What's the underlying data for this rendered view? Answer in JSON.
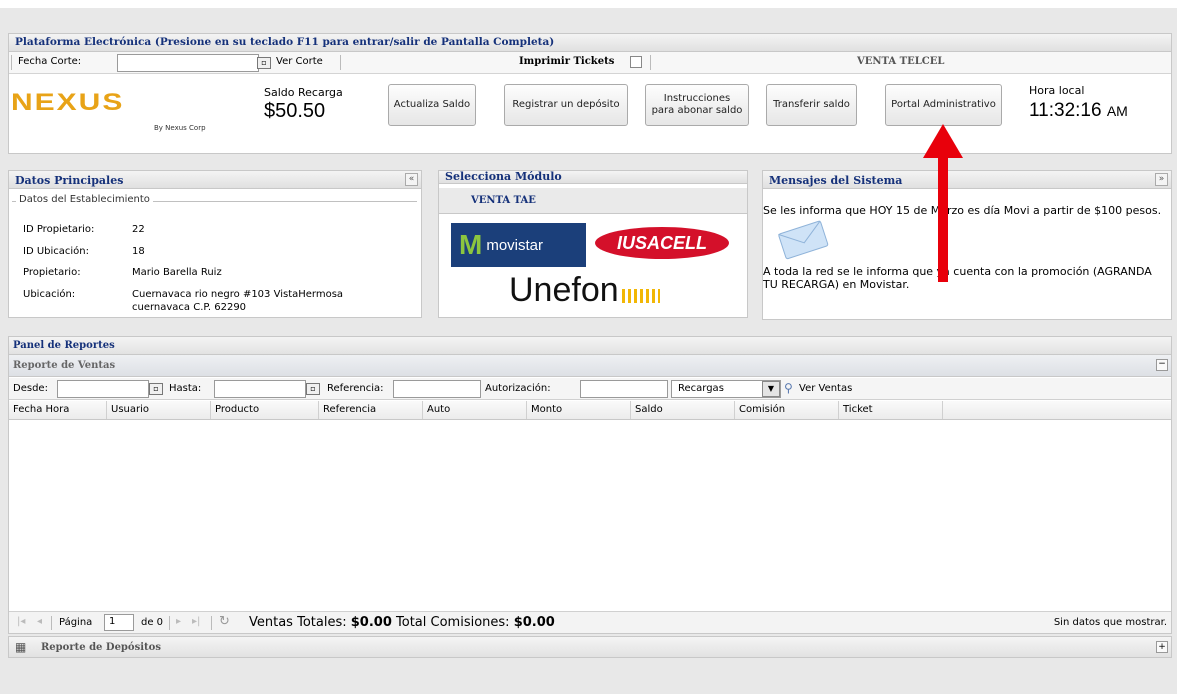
{
  "header": {
    "title": "Plataforma Electrónica (Presione en su teclado F11 para entrar/salir de Pantalla Completa)",
    "fecha_corte_label": "Fecha Corte:",
    "ver_corte_label": "Ver Corte",
    "imprimir_tickets_label": "Imprimir Tickets",
    "venta_label": "VENTA TELCEL"
  },
  "brand": {
    "logo_text": "NEXUS",
    "logo_sub": "By Nexus Corp",
    "accent": "#e8a317"
  },
  "balance": {
    "label": "Saldo Recarga",
    "value": "$50.50"
  },
  "toolbar": {
    "actualiza_label": "Actualiza Saldo",
    "registrar_label": "Registrar un depósito",
    "instrucciones_line1": "Instrucciones",
    "instrucciones_line2": "para abonar saldo",
    "transferir_label": "Transferir saldo",
    "portal_label": "Portal Administrativo"
  },
  "clock": {
    "label": "Hora local",
    "time": "11:32:16",
    "ampm": "AM"
  },
  "datos": {
    "title": "Datos Principales",
    "collapse_icon": "«",
    "fieldset": "Datos del Establecimiento",
    "rows": [
      {
        "label": "ID Propietario:",
        "value": "22"
      },
      {
        "label": "ID Ubicación:",
        "value": "18"
      },
      {
        "label": "Propietario:",
        "value": "Mario Barella Ruiz"
      },
      {
        "label": "Ubicación:",
        "value": "Cuernavaca rio negro #103 VistaHermosa",
        "value2": "cuernavaca C.P. 62290"
      }
    ]
  },
  "modulo": {
    "title": "Selecciona Módulo",
    "tab": "VENTA TAE",
    "movistar": "movistar",
    "iusacell": "IUSACELL",
    "unefon": "Unefon"
  },
  "mensajes": {
    "title": "Mensajes del Sistema",
    "expand_icon": "»",
    "msg1": "Se les informa que HOY 15 de Marzo es día Movi a partir de $100 pesos.",
    "msg2": "A toda la red se le informa que  ya cuenta con la promoción (AGRANDA TU RECARGA) en Movistar."
  },
  "reportes": {
    "panel_title": "Panel de Reportes",
    "ventas_title": "Reporte de Ventas",
    "desde_label": "Desde:",
    "hasta_label": "Hasta:",
    "referencia_label": "Referencia:",
    "autorizacion_label": "Autorización:",
    "tipo_value": "Recargas",
    "ver_ventas_label": "Ver Ventas",
    "columns": [
      "Fecha Hora",
      "Usuario",
      "Producto",
      "Referencia",
      "Auto",
      "Monto",
      "Saldo",
      "Comisión",
      "Ticket"
    ],
    "pagina_label": "Página",
    "page_value": "1",
    "de_label": "de 0",
    "ventas_totales_label": "Ventas Totales:",
    "ventas_totales_value": "$0.00",
    "total_comisiones_label": "Total Comisiones:",
    "total_comisiones_value": "$0.00",
    "sin_datos": "Sin datos que mostrar.",
    "depositos_title": "Reporte de Depósitos"
  },
  "annotation": {
    "arrow_color": "#e8000b"
  }
}
